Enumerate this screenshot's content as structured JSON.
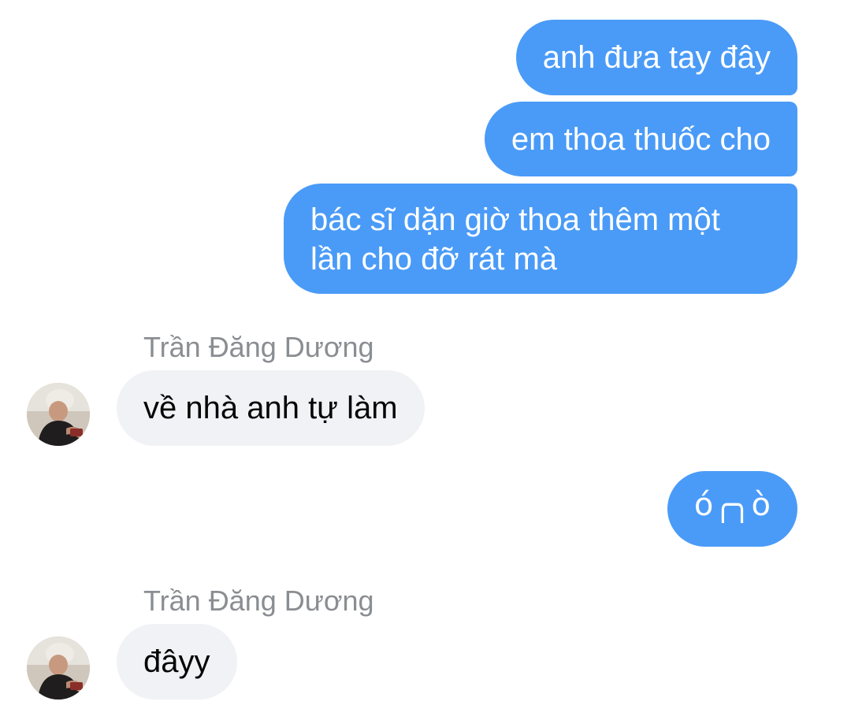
{
  "messages": {
    "outgoing_1": "anh đưa tay đây",
    "outgoing_2": "em thoa thuốc cho",
    "outgoing_3": "bác sĩ dặn giờ thoa thêm một lần cho đỡ rát mà",
    "incoming_1_sender": "Trần Đăng Dương",
    "incoming_1": "về nhà anh tự làm",
    "outgoing_4": "ó╭╮ò",
    "incoming_2_sender": "Trần Đăng Dương",
    "incoming_2": "đâyy"
  },
  "colors": {
    "outgoing_bubble": "#4a9bf7",
    "incoming_bubble": "#f1f2f6",
    "sender_name": "#8a8d91"
  }
}
